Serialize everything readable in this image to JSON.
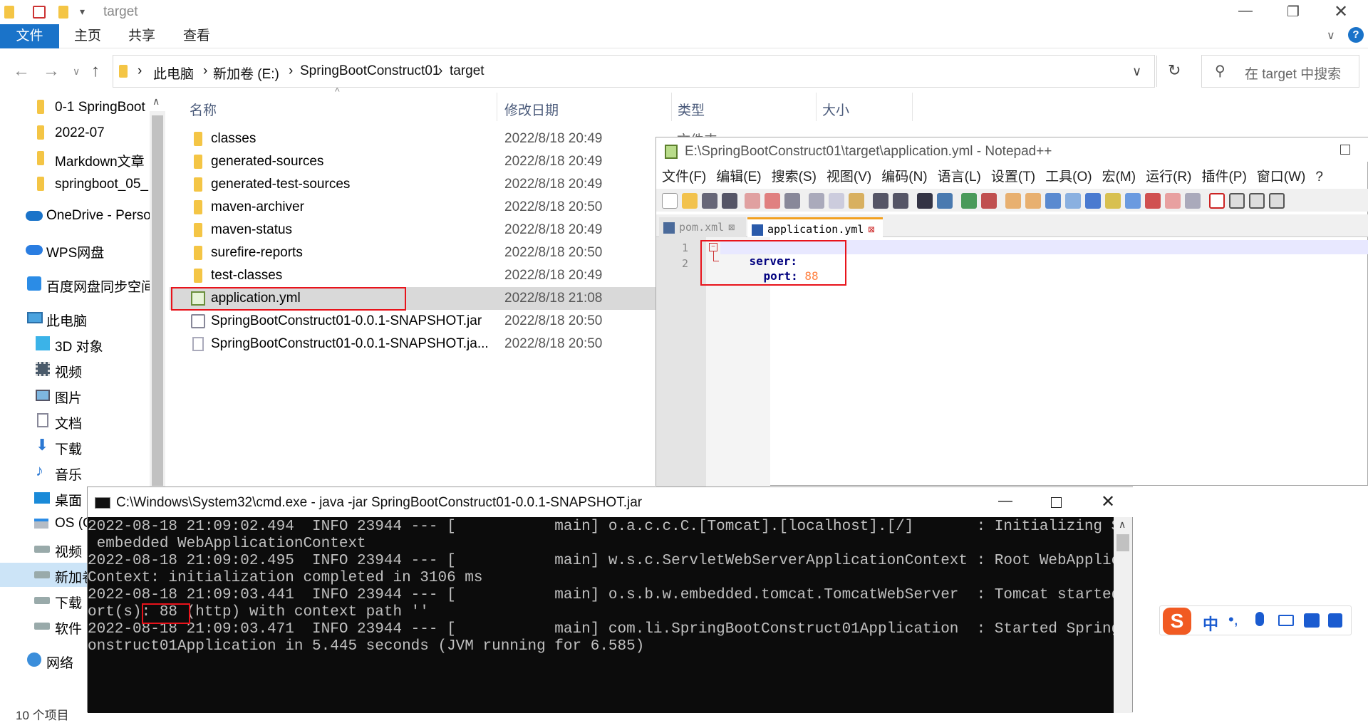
{
  "explorer": {
    "window_title": "target",
    "ribbon_tabs": [
      "文件",
      "主页",
      "共享",
      "查看"
    ],
    "breadcrumb": [
      "此电脑",
      "新加卷 (E:)",
      "SpringBootConstruct01",
      "target"
    ],
    "search_placeholder": "在 target 中搜索",
    "sidebar": [
      "0-1 SpringBoot",
      "2022-07",
      "Markdown文章",
      "springboot_05_",
      "OneDrive - Perso",
      "WPS网盘",
      "百度网盘同步空间",
      "此电脑",
      "3D 对象",
      "视频",
      "图片",
      "文档",
      "下载",
      "音乐",
      "桌面",
      "OS (C",
      "视频",
      "新加卷",
      "下载",
      "软件",
      "网络"
    ],
    "columns": {
      "name": "名称",
      "date": "修改日期",
      "type": "类型",
      "size": "大小"
    },
    "files": [
      {
        "name": "classes",
        "date": "2022/8/18 20:49"
      },
      {
        "name": "generated-sources",
        "date": "2022/8/18 20:49"
      },
      {
        "name": "generated-test-sources",
        "date": "2022/8/18 20:49"
      },
      {
        "name": "maven-archiver",
        "date": "2022/8/18 20:50"
      },
      {
        "name": "maven-status",
        "date": "2022/8/18 20:49"
      },
      {
        "name": "surefire-reports",
        "date": "2022/8/18 20:50"
      },
      {
        "name": "test-classes",
        "date": "2022/8/18 20:49"
      },
      {
        "name": "application.yml",
        "date": "2022/8/18 21:08"
      },
      {
        "name": "SpringBootConstruct01-0.0.1-SNAPSHOT.jar",
        "date": "2022/8/18 20:50"
      },
      {
        "name": "SpringBootConstruct01-0.0.1-SNAPSHOT.ja...",
        "date": "2022/8/18 20:50"
      }
    ],
    "status": "10 个项目",
    "peek_type": "文件夹"
  },
  "notepad": {
    "title": "E:\\SpringBootConstruct01\\target\\application.yml - Notepad++",
    "menu": [
      "文件(F)",
      "编辑(E)",
      "搜索(S)",
      "视图(V)",
      "编码(N)",
      "语言(L)",
      "设置(T)",
      "工具(O)",
      "宏(M)",
      "运行(R)",
      "插件(P)",
      "窗口(W)",
      "?"
    ],
    "tabs": [
      "pom.xml",
      "application.yml"
    ],
    "line_numbers": [
      "1",
      "2"
    ],
    "code": {
      "l1_key": "server:",
      "l2_key": "port:",
      "l2_val": "88"
    }
  },
  "cmd": {
    "title": "C:\\Windows\\System32\\cmd.exe - java  -jar SpringBootConstruct01-0.0.1-SNAPSHOT.jar",
    "lines": [
      "2022-08-18 21:09:02.494  INFO 23944 --- [           main] o.a.c.c.C.[Tomcat].[localhost].[/]       : Initializing Spring",
      " embedded WebApplicationContext",
      "2022-08-18 21:09:02.495  INFO 23944 --- [           main] w.s.c.ServletWebServerApplicationContext : Root WebApplication",
      "Context: initialization completed in 3106 ms",
      "2022-08-18 21:09:03.441  INFO 23944 --- [           main] o.s.b.w.embedded.tomcat.TomcatWebServer  : Tomcat started on p",
      "ort(s): 88 (http) with context path ''",
      "2022-08-18 21:09:03.471  INFO 23944 --- [           main] com.li.SpringBootConstruct01Application  : Started SpringBootC",
      "onstruct01Application in 5.445 seconds (JVM running for 6.585)"
    ]
  },
  "ime": {
    "lang": "中"
  }
}
